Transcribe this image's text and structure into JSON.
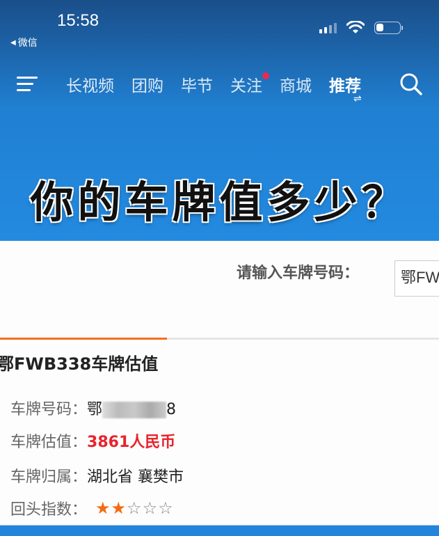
{
  "status_bar": {
    "time": "15:58",
    "back_label": "微信",
    "back_icon": "back-triangle-icon",
    "signal_icon": "signal-icon",
    "wifi_icon": "wifi-icon",
    "battery_icon": "battery-icon",
    "battery_level": 0.25
  },
  "nav": {
    "menu_icon": "menu-icon",
    "items": [
      {
        "label": "长视频",
        "active": false,
        "badge": false
      },
      {
        "label": "团购",
        "active": false,
        "badge": false
      },
      {
        "label": "毕节",
        "active": false,
        "badge": false
      },
      {
        "label": "关注",
        "active": false,
        "badge": true
      },
      {
        "label": "商城",
        "active": false,
        "badge": false
      },
      {
        "label": "推荐",
        "active": true,
        "badge": false
      }
    ],
    "active_indicator": "⇌",
    "search_icon": "search-icon",
    "badge_color": "#f0284a"
  },
  "banner": {
    "title": "你的车牌值多少？"
  },
  "form": {
    "label": "请输入车牌号码：",
    "input_value": "鄂FW"
  },
  "result": {
    "title": "鄂FWB338车牌估值",
    "rows": [
      {
        "label": "车牌号码：",
        "value_prefix": "鄂",
        "value_suffix": "8",
        "blurred": true
      },
      {
        "label": "车牌估值：",
        "value": "3861人民币",
        "highlight": true
      },
      {
        "label": "车牌归属：",
        "value": "湖北省 襄樊市"
      },
      {
        "label": "回头指数：",
        "rating": 2,
        "rating_max": 5
      }
    ],
    "accent_color": "#f07020",
    "value_color": "#e8242c",
    "star_color": "#f36b10"
  }
}
